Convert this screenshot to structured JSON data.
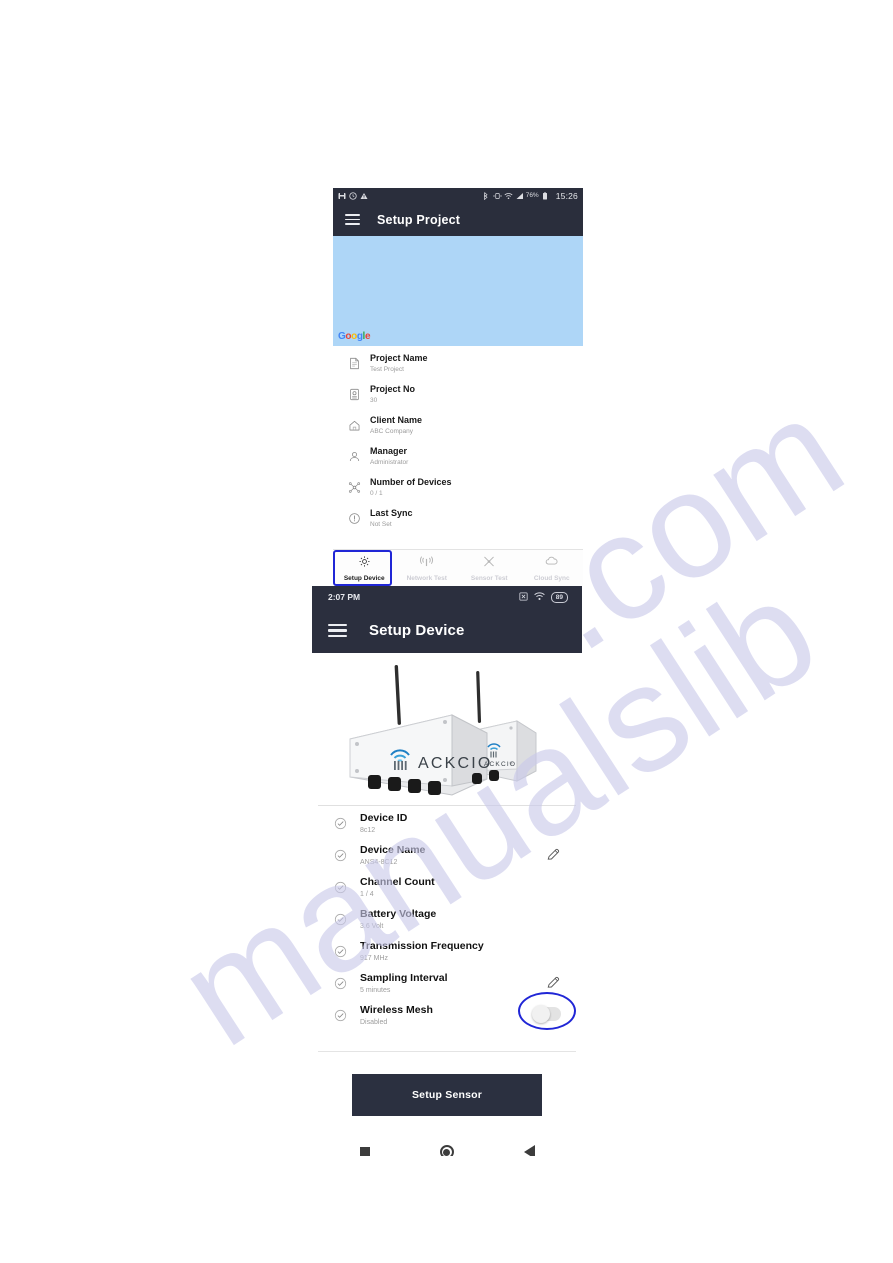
{
  "watermark": {
    "line1": "manualslib",
    "line2": ".com"
  },
  "screen_project": {
    "status_bar": {
      "time": "15:26",
      "battery_percent": "76%",
      "left_icons": [
        "save-icon",
        "clock-icon",
        "warning-icon"
      ],
      "right_icons": [
        "bluetooth-icon",
        "vibrate-icon",
        "wifi-icon",
        "signal-icon",
        "battery-icon"
      ]
    },
    "app_bar": {
      "menu_icon": "hamburger-menu-icon",
      "title": "Setup Project"
    },
    "map": {
      "provider_logo": "Google",
      "logo_letters": [
        "G",
        "o",
        "o",
        "g",
        "l",
        "e"
      ]
    },
    "details": [
      {
        "icon": "document-icon",
        "label": "Project Name",
        "value": "Test Project"
      },
      {
        "icon": "id-card-icon",
        "label": "Project No",
        "value": "30"
      },
      {
        "icon": "home-icon",
        "label": "Client Name",
        "value": "ABC Company"
      },
      {
        "icon": "person-icon",
        "label": "Manager",
        "value": "Administrator"
      },
      {
        "icon": "network-hub-icon",
        "label": "Number of Devices",
        "value": "0 / 1"
      },
      {
        "icon": "info-icon",
        "label": "Last Sync",
        "value": "Not Set"
      }
    ],
    "tabs": [
      {
        "icon": "gear-icon",
        "label": "Setup Device",
        "active": true
      },
      {
        "icon": "antenna-icon",
        "label": "Network Test",
        "active": false
      },
      {
        "icon": "sensor-icon",
        "label": "Sensor Test",
        "active": false
      },
      {
        "icon": "cloud-sync-icon",
        "label": "Cloud Sync",
        "active": false
      }
    ],
    "annotation": {
      "type": "rectangle",
      "color": "#2026d6",
      "targets": "setup-device-tab"
    }
  },
  "screen_device": {
    "status_bar": {
      "time": "2:07 PM",
      "battery_percent": "89",
      "right_icons": [
        "no-sim-icon",
        "wifi-icon",
        "battery-icon"
      ]
    },
    "app_bar": {
      "menu_icon": "hamburger-menu-icon",
      "title": "Setup Device"
    },
    "hero_image": {
      "alt": "Two white ACKCIO wireless sensor node enclosures with antennas",
      "brand": "ACKCIO"
    },
    "details": [
      {
        "label": "Device ID",
        "value": "8c12",
        "status": "checked",
        "action": "none"
      },
      {
        "label": "Device Name",
        "value": "ANS4-8C12",
        "status": "checked",
        "action": "edit-pencil-icon"
      },
      {
        "label": "Channel Count",
        "value": "1 / 4",
        "status": "checked",
        "action": "none"
      },
      {
        "label": "Battery Voltage",
        "value": "3.6 Volt",
        "status": "checked",
        "action": "none"
      },
      {
        "label": "Transmission Frequency",
        "value": "917 MHz",
        "status": "checked",
        "action": "none"
      },
      {
        "label": "Sampling Interval",
        "value": "5 minutes",
        "status": "checked",
        "action": "edit-pencil-icon"
      },
      {
        "label": "Wireless Mesh",
        "value": "Disabled",
        "status": "checked",
        "action": "toggle-off"
      }
    ],
    "primary_button": {
      "label": "Setup Sensor"
    },
    "nav_bar": {
      "recents": "square-icon",
      "home": "circle-icon",
      "back": "back-triangle-icon"
    },
    "annotation": {
      "type": "ellipse",
      "color": "#2026d6",
      "targets": "wireless-mesh-toggle"
    }
  },
  "colors": {
    "app_bar": "#2b2f3e",
    "accent_annotation": "#2026d6",
    "map_fill": "#aed6f7",
    "button_bg": "#2b3040",
    "watermark": "#c9c9ea"
  }
}
